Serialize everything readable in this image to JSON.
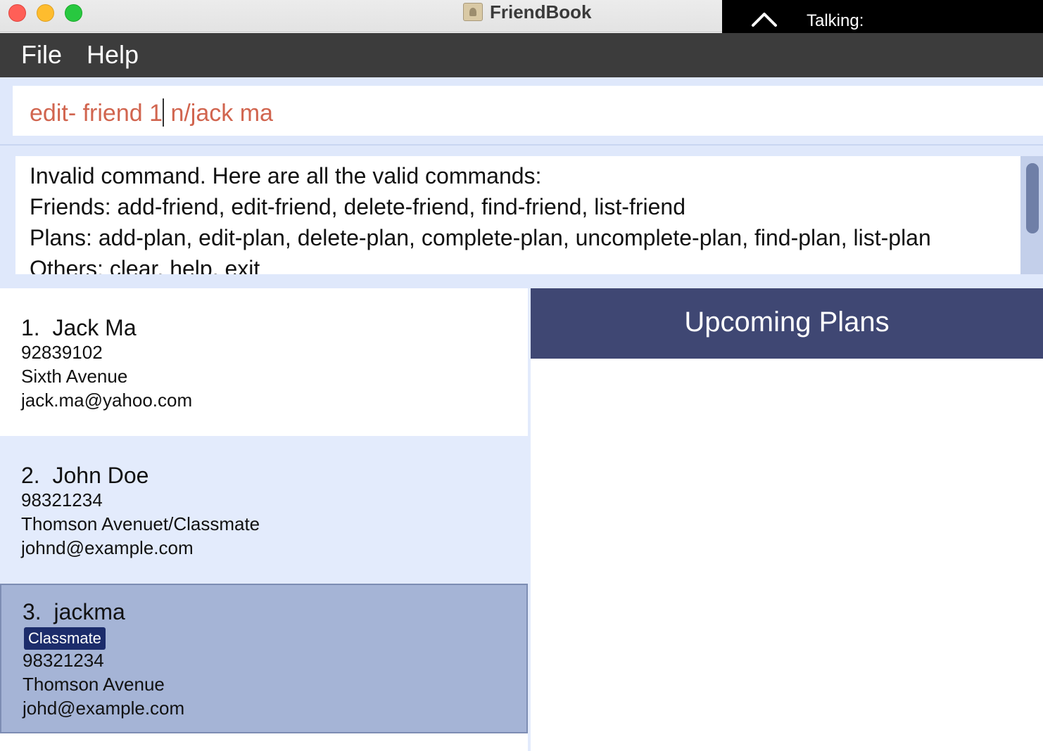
{
  "window": {
    "title": "FriendBook",
    "icon": "contacts-book-icon"
  },
  "overlay": {
    "label": "Talking:",
    "icon": "chevron-up-icon"
  },
  "menu": {
    "items": [
      {
        "label": "File"
      },
      {
        "label": "Help"
      }
    ]
  },
  "command": {
    "value_before_caret": "edit- friend 1",
    "value_after_caret": " n/jack ma",
    "color": "#d1654f"
  },
  "result": {
    "lines": [
      "Invalid command. Here are all the valid commands:",
      "Friends: add-friend, edit-friend, delete-friend, find-friend, list-friend",
      "Plans: add-plan, edit-plan, delete-plan, complete-plan, uncomplete-plan, find-plan, list-plan",
      "Others: clear, help, exit"
    ]
  },
  "friends": [
    {
      "index": "1.",
      "name": "Jack Ma",
      "phone": "92839102",
      "address": "Sixth Avenue",
      "email": "jack.ma@yahoo.com"
    },
    {
      "index": "2.",
      "name": "John Doe",
      "phone": "98321234",
      "address": "Thomson Avenuet/Classmate",
      "email": "johnd@example.com"
    },
    {
      "index": "3.",
      "name": "jackma",
      "tag": "Classmate",
      "phone": "98321234",
      "address": "Thomson Avenue",
      "email": "johd@example.com",
      "selected": true
    }
  ],
  "plans": {
    "title": "Upcoming Plans"
  },
  "colors": {
    "menubar": "#3c3c3c",
    "plans_header": "#3f4773",
    "selected_card": "#a5b4d6",
    "tag_bg": "#1c2c6b"
  }
}
